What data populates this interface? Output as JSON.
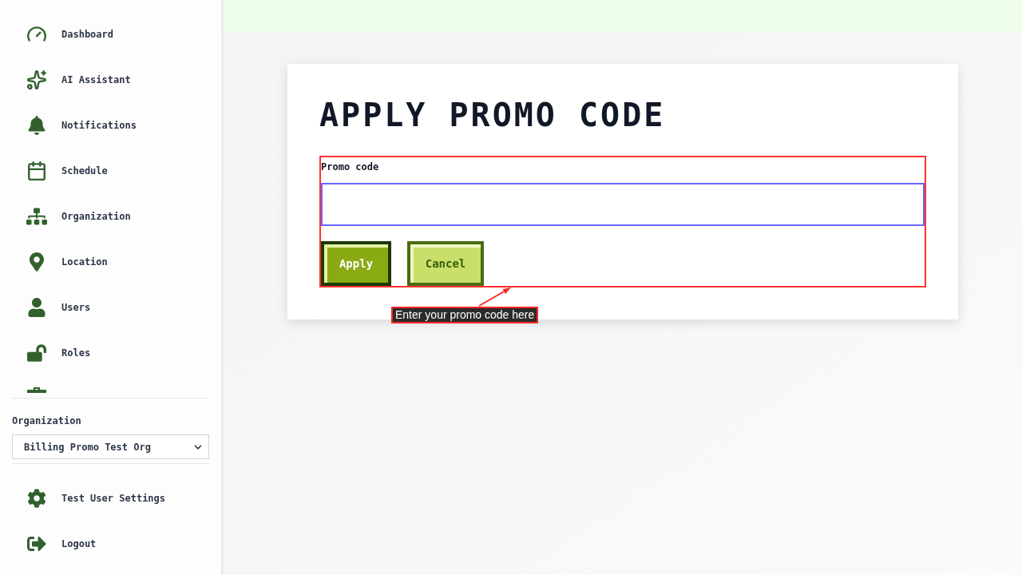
{
  "sidebar": {
    "nav_items": [
      {
        "label": "Dashboard"
      },
      {
        "label": "AI Assistant"
      },
      {
        "label": "Notifications"
      },
      {
        "label": "Schedule"
      },
      {
        "label": "Organization"
      },
      {
        "label": "Location"
      },
      {
        "label": "Users"
      },
      {
        "label": "Roles"
      }
    ],
    "organization_picker": {
      "label": "Organization",
      "value": "Billing Promo Test Org"
    },
    "footer_items": [
      {
        "label": "Test User Settings"
      },
      {
        "label": "Logout"
      }
    ]
  },
  "page": {
    "title": "APPLY PROMO CODE",
    "form": {
      "label": "Promo code",
      "buttons": [
        {
          "label": "Apply",
          "kind": "primary"
        },
        {
          "label": "Cancel",
          "kind": "secondary"
        }
      ]
    },
    "annotation": {
      "label": "Enter your promo code here"
    }
  }
}
